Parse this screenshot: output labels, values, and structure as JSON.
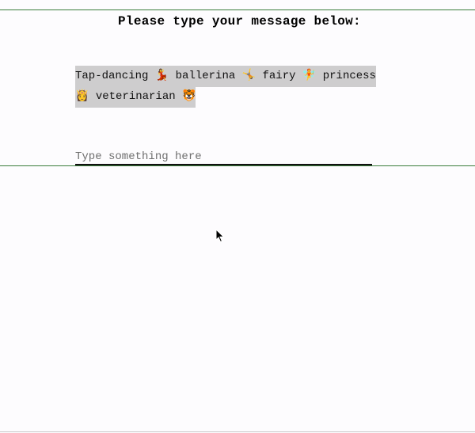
{
  "heading": "Please type your message below:",
  "message": "Tap-dancing 💃 ballerina 🤸 fairy 🧚 princess 👸 veterinarian 🐯",
  "input": {
    "value": "",
    "placeholder": "Type something here"
  },
  "colors": {
    "accent_rule": "#3a7d3a",
    "message_highlight": "#cecdce",
    "underline": "#111111"
  }
}
